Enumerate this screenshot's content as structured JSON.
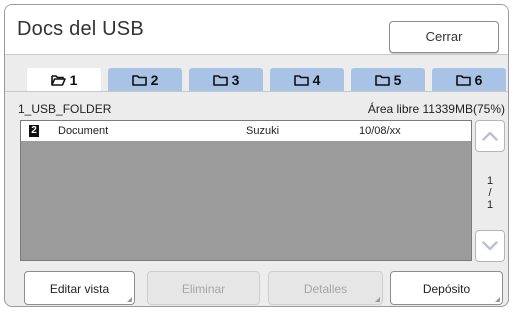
{
  "window": {
    "title": "Docs del USB",
    "close_label": "Cerrar"
  },
  "tabs": [
    {
      "label": "1",
      "icon": "folder-open-icon",
      "active": true
    },
    {
      "label": "2",
      "icon": "folder-icon",
      "active": false
    },
    {
      "label": "3",
      "icon": "folder-icon",
      "active": false
    },
    {
      "label": "4",
      "icon": "folder-icon",
      "active": false
    },
    {
      "label": "5",
      "icon": "folder-icon",
      "active": false
    },
    {
      "label": "6",
      "icon": "folder-icon",
      "active": false
    }
  ],
  "folder": {
    "name": "1_USB_FOLDER",
    "free_space": "Área libre 11339MB(75%)"
  },
  "documents": [
    {
      "badge": "2",
      "name": "Document",
      "owner": "Suzuki",
      "date": "10/08/xx"
    }
  ],
  "pagination": {
    "current": "1",
    "separator": "/",
    "total": "1"
  },
  "buttons": {
    "edit_view": "Editar vista",
    "delete": "Eliminar",
    "details": "Detalles",
    "deposit": "Depósito"
  },
  "colors": {
    "tab_inactive": "#a9c3e6",
    "list_empty_area": "#9b9b9b",
    "frame_background": "#ececec"
  }
}
